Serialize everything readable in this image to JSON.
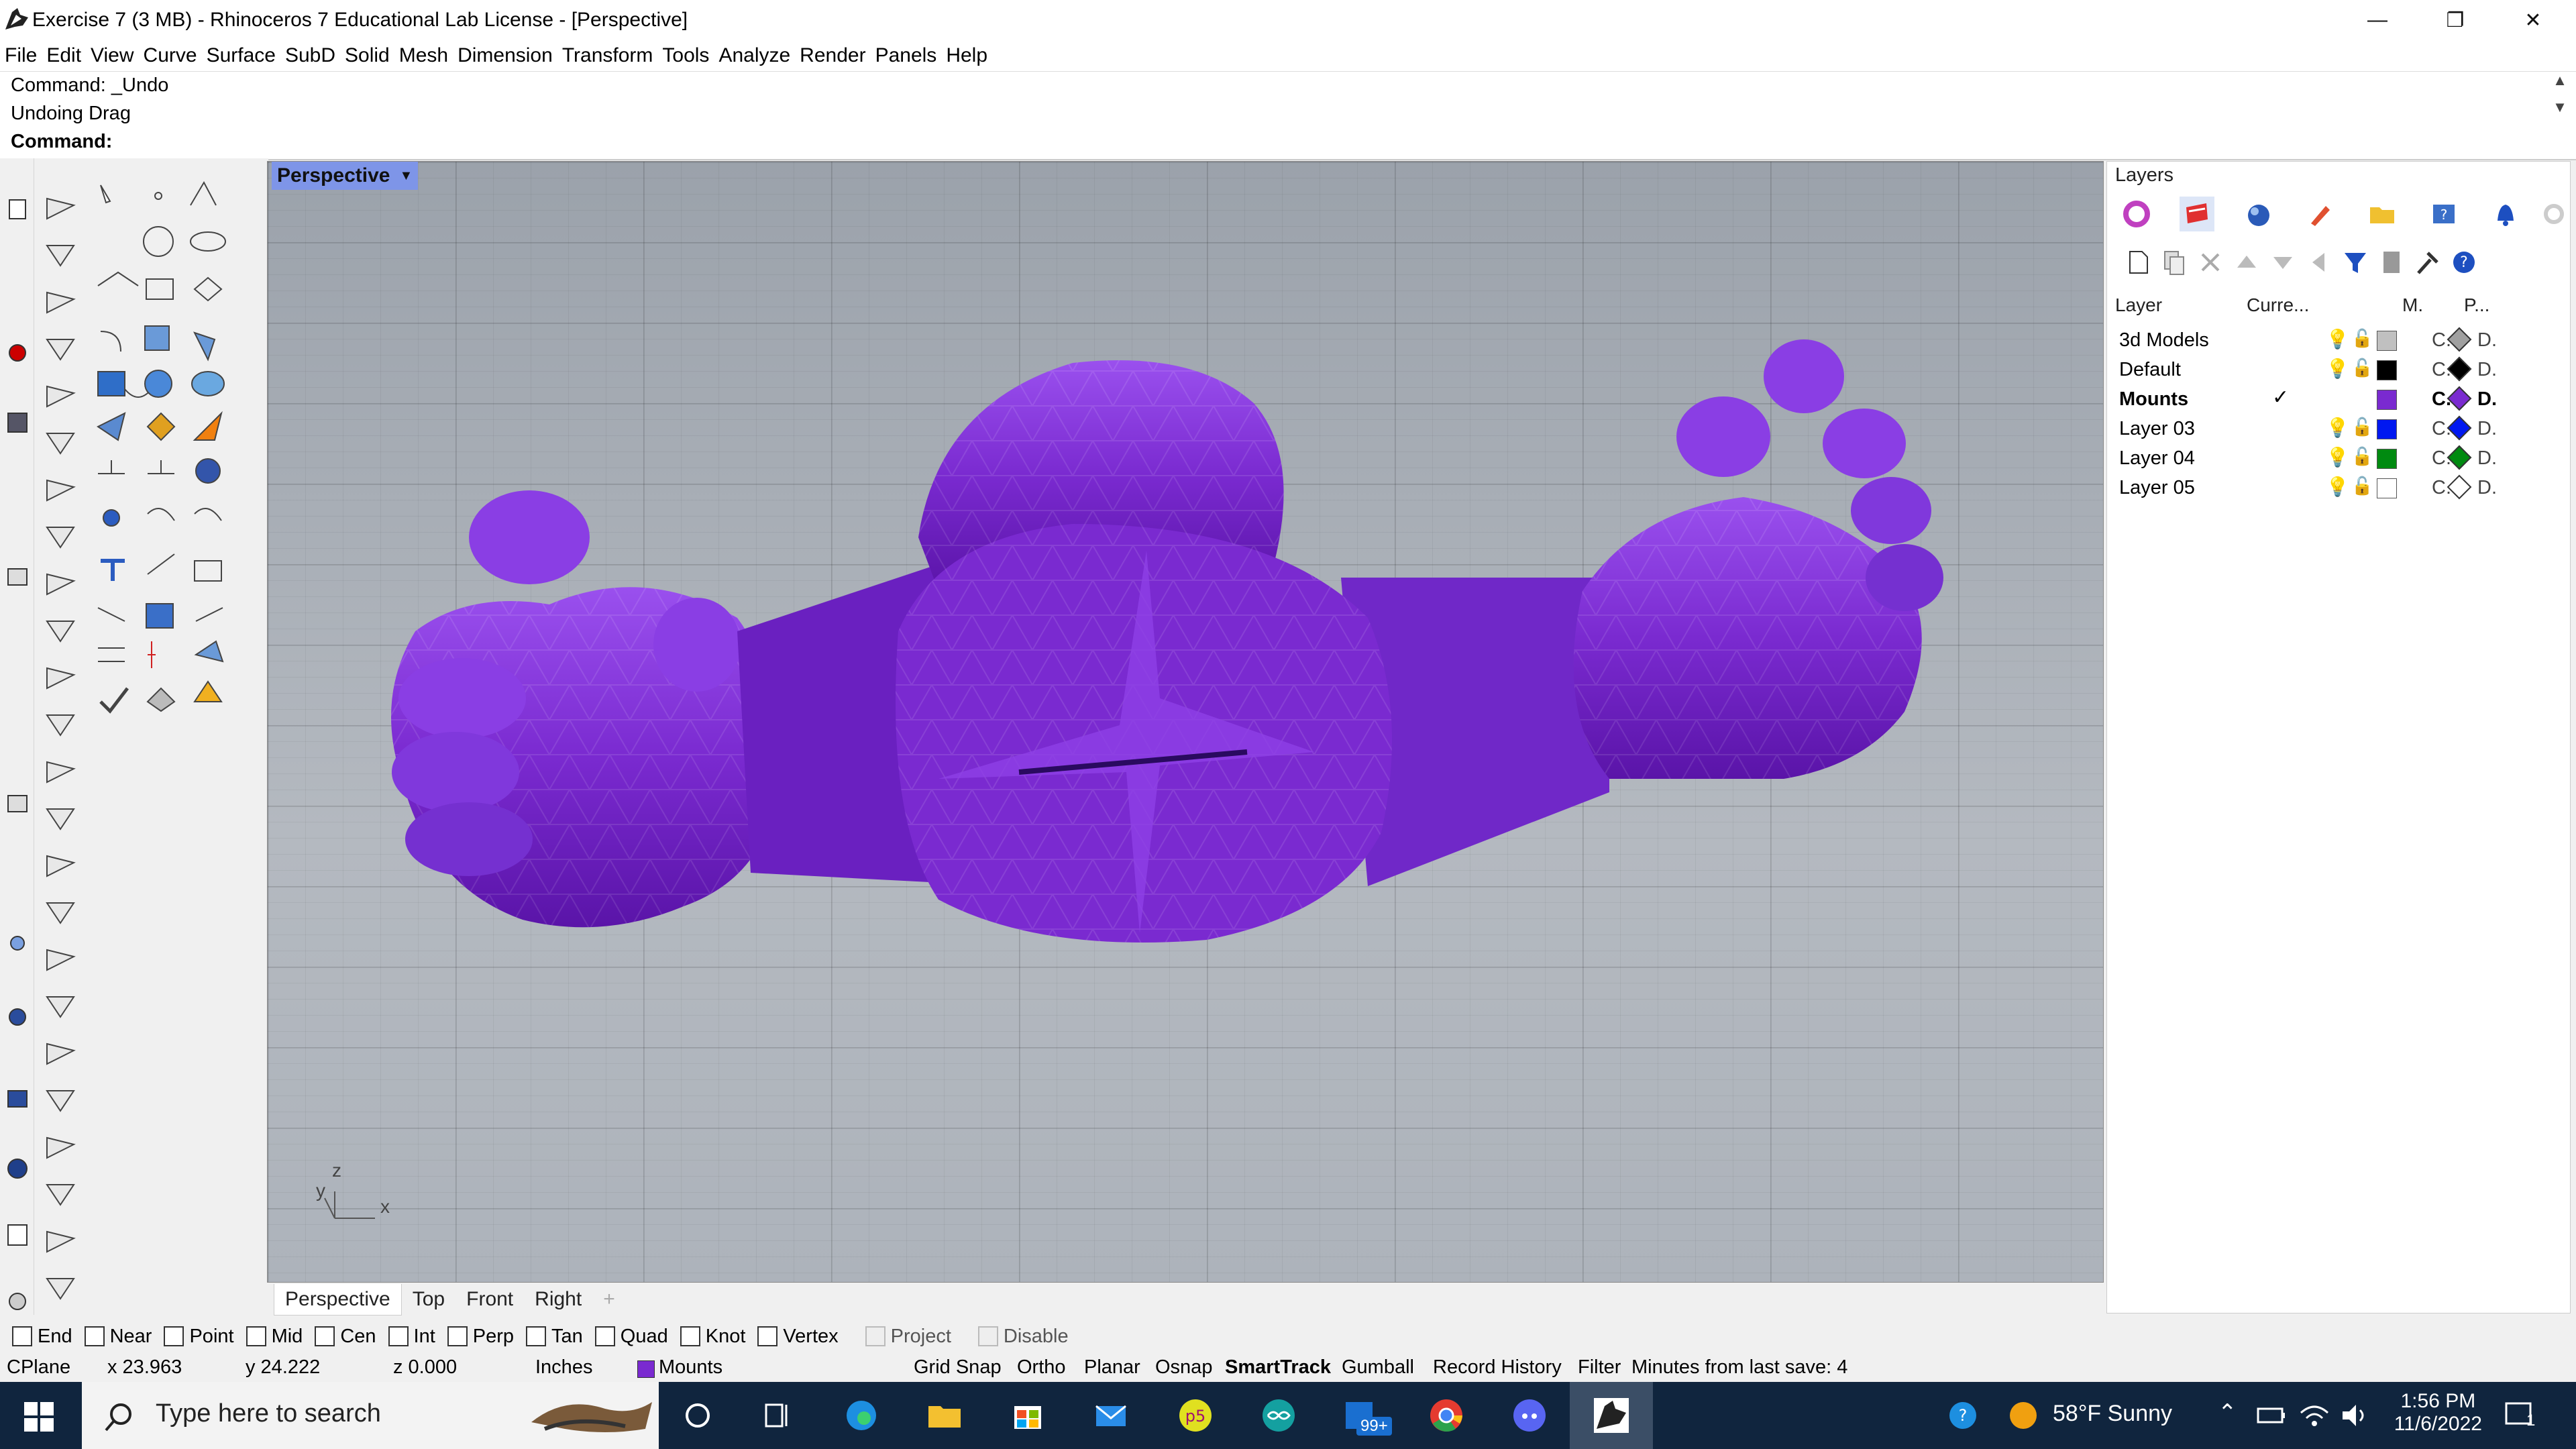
{
  "window": {
    "title": "Exercise 7 (3 MB) - Rhinoceros 7 Educational Lab License - [Perspective]",
    "minimize": "—",
    "maximize": "❐",
    "close": "✕"
  },
  "menu": [
    "File",
    "Edit",
    "View",
    "Curve",
    "Surface",
    "SubD",
    "Solid",
    "Mesh",
    "Dimension",
    "Transform",
    "Tools",
    "Analyze",
    "Render",
    "Panels",
    "Help"
  ],
  "command_history": [
    "Command: _Undo",
    "Undoing Drag"
  ],
  "command_prompt": "Command:",
  "viewport": {
    "name": "Perspective",
    "axis_labels": {
      "z": "z",
      "y": "y",
      "x": "x"
    },
    "tabs": [
      "Perspective",
      "Top",
      "Front",
      "Right"
    ],
    "add_tab": "+"
  },
  "layers_panel": {
    "title": "Layers",
    "columns": {
      "layer": "Layer",
      "current": "Curre...",
      "material": "M.",
      "print": "P..."
    },
    "rows": [
      {
        "name": "3d Models",
        "color": "#c0c0c0",
        "current": false,
        "c": "C.",
        "d": "D.",
        "diamond": "#a0a0a0"
      },
      {
        "name": "Default",
        "color": "#000000",
        "current": false,
        "c": "C.",
        "d": "D.",
        "diamond": "#000000"
      },
      {
        "name": "Mounts",
        "color": "#7a2ad0",
        "current": true,
        "check": "✓",
        "c": "C.",
        "d": "D.",
        "diamond": "#7a2ad0"
      },
      {
        "name": "Layer 03",
        "color": "#0018f0",
        "current": false,
        "c": "C.",
        "d": "D.",
        "diamond": "#0018f0"
      },
      {
        "name": "Layer 04",
        "color": "#008a10",
        "current": false,
        "c": "C.",
        "d": "D.",
        "diamond": "#008a10"
      },
      {
        "name": "Layer 05",
        "color": "#ffffff",
        "current": false,
        "c": "C.",
        "d": "D.",
        "diamond": "#ffffff"
      }
    ]
  },
  "osnaps": [
    {
      "label": "End",
      "checked": false,
      "disabled": false
    },
    {
      "label": "Near",
      "checked": false,
      "disabled": false
    },
    {
      "label": "Point",
      "checked": false,
      "disabled": false
    },
    {
      "label": "Mid",
      "checked": false,
      "disabled": false
    },
    {
      "label": "Cen",
      "checked": false,
      "disabled": false
    },
    {
      "label": "Int",
      "checked": false,
      "disabled": false
    },
    {
      "label": "Perp",
      "checked": false,
      "disabled": false
    },
    {
      "label": "Tan",
      "checked": false,
      "disabled": false
    },
    {
      "label": "Quad",
      "checked": false,
      "disabled": false
    },
    {
      "label": "Knot",
      "checked": false,
      "disabled": false
    },
    {
      "label": "Vertex",
      "checked": false,
      "disabled": false
    },
    {
      "label": "Project",
      "checked": false,
      "disabled": true
    },
    {
      "label": "Disable",
      "checked": false,
      "disabled": true
    }
  ],
  "status": {
    "cplane": "CPlane",
    "x": "x 23.963",
    "y": "y 24.222",
    "z": "z 0.000",
    "units": "Inches",
    "layer": "Mounts",
    "layer_color": "#7a2ad0",
    "grid_snap": "Grid Snap",
    "ortho": "Ortho",
    "planar": "Planar",
    "osnap": "Osnap",
    "smarttrack": "SmartTrack",
    "gumball": "Gumball",
    "record_history": "Record History",
    "filter": "Filter",
    "save_info": "Minutes from last save: 4"
  },
  "taskbar": {
    "search_placeholder": "Type here to search",
    "badge": "99+",
    "weather": "58°F  Sunny",
    "time": "1:56 PM",
    "date": "11/6/2022",
    "notifications": "1"
  },
  "colors": {
    "model": "#7a2ad0",
    "viewport_label": "#7e95e8",
    "taskbar": "#10253e"
  }
}
